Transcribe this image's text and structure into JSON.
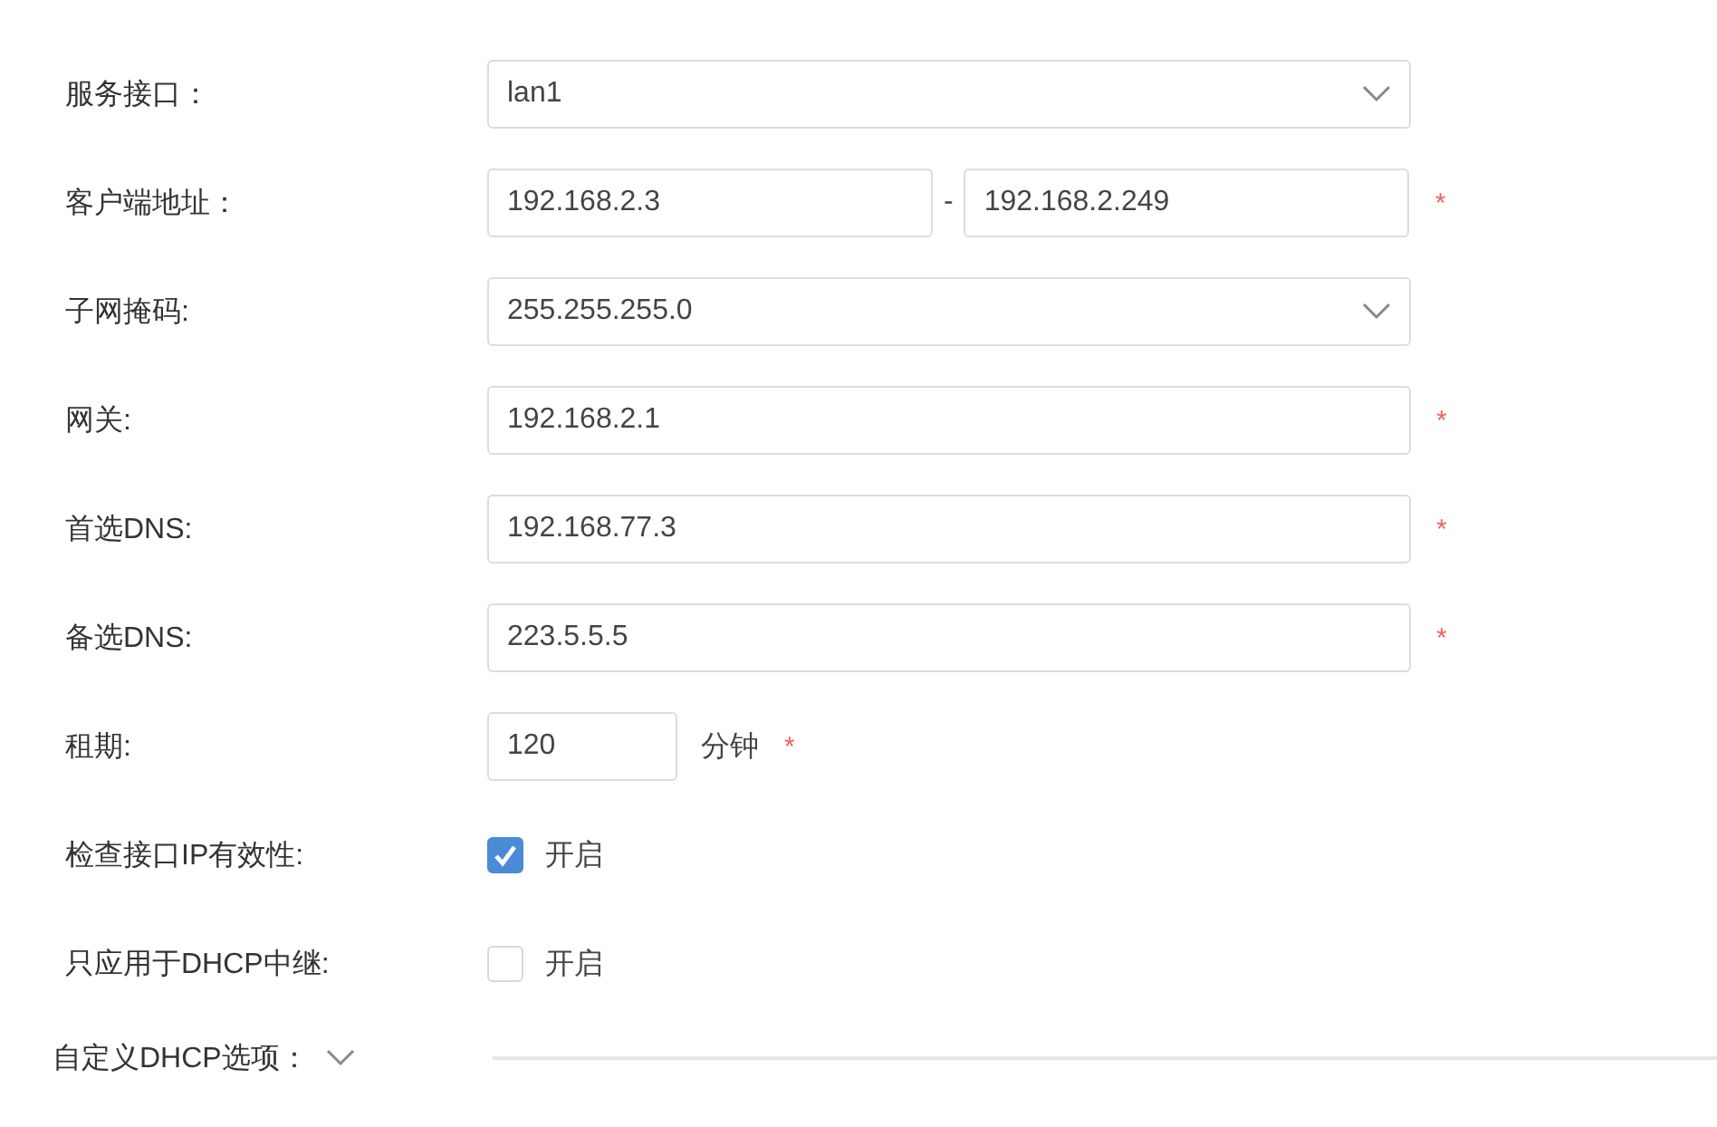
{
  "fields": [
    {
      "kind": "select",
      "label": "服务接口：",
      "value": "lan1"
    },
    {
      "kind": "range",
      "label": "客户端地址：",
      "from": "192.168.2.3",
      "separator": "-",
      "to": "192.168.2.249",
      "mark": "*"
    },
    {
      "kind": "select",
      "label": "子网掩码:",
      "value": "255.255.255.0"
    },
    {
      "kind": "text",
      "label": "网关:",
      "value": "192.168.2.1",
      "mark": "*"
    },
    {
      "kind": "text",
      "label": "首选DNS:",
      "value": "192.168.77.3",
      "mark": "*"
    },
    {
      "kind": "text",
      "label": "备选DNS:",
      "value": "223.5.5.5",
      "mark": "*"
    },
    {
      "kind": "number",
      "label": "租期:",
      "value": "120",
      "unit": "分钟",
      "mark": "*"
    },
    {
      "kind": "checkbox",
      "label": "检查接口IP有效性:",
      "checked": true,
      "text": "开启"
    },
    {
      "kind": "checkbox",
      "label": "只应用于DHCP中继:",
      "checked": false,
      "text": "开启"
    }
  ],
  "section": {
    "title": "自定义DHCP选项：",
    "expanded": false
  }
}
